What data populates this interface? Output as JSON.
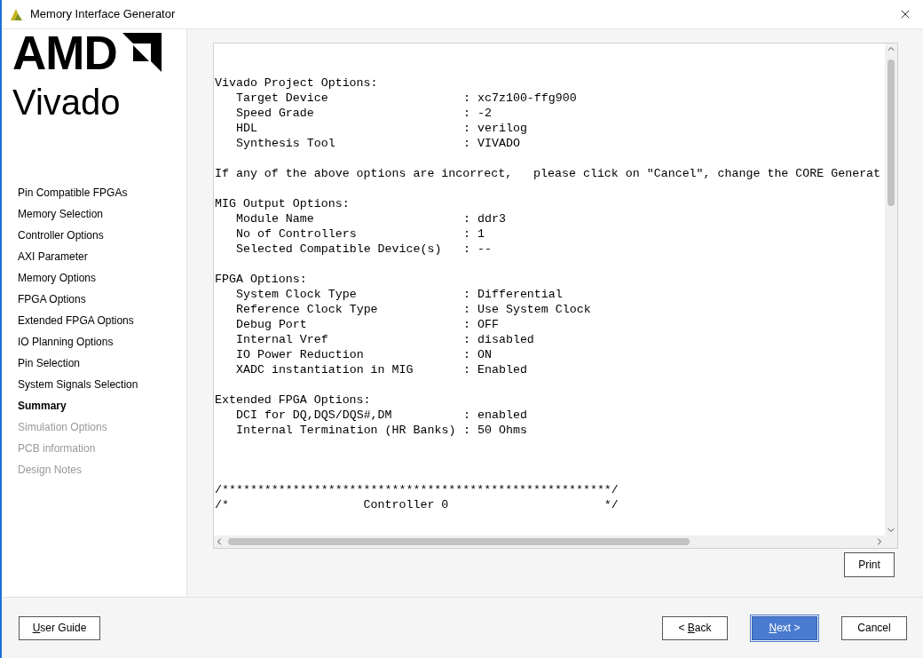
{
  "window": {
    "title": "Memory Interface Generator"
  },
  "logo": {
    "brand": "AMD",
    "product": "Vivado"
  },
  "sidebar": {
    "items": [
      {
        "label": "Pin Compatible FPGAs",
        "selected": false,
        "disabled": false
      },
      {
        "label": "Memory Selection",
        "selected": false,
        "disabled": false
      },
      {
        "label": "Controller Options",
        "selected": false,
        "disabled": false
      },
      {
        "label": "AXI Parameter",
        "selected": false,
        "disabled": false
      },
      {
        "label": "Memory Options",
        "selected": false,
        "disabled": false
      },
      {
        "label": "FPGA Options",
        "selected": false,
        "disabled": false
      },
      {
        "label": "Extended FPGA Options",
        "selected": false,
        "disabled": false
      },
      {
        "label": "IO Planning Options",
        "selected": false,
        "disabled": false
      },
      {
        "label": "Pin Selection",
        "selected": false,
        "disabled": false
      },
      {
        "label": "System Signals Selection",
        "selected": false,
        "disabled": false
      },
      {
        "label": "Summary",
        "selected": true,
        "disabled": false
      },
      {
        "label": "Simulation Options",
        "selected": false,
        "disabled": true
      },
      {
        "label": "PCB information",
        "selected": false,
        "disabled": true
      },
      {
        "label": "Design Notes",
        "selected": false,
        "disabled": true
      }
    ]
  },
  "report": {
    "separator": ":",
    "blocks": [
      {
        "kind": "section",
        "heading": "Vivado Project Options:",
        "rows": [
          {
            "label": "Target Device",
            "value": "xc7z100-ffg900"
          },
          {
            "label": "Speed Grade",
            "value": "-2"
          },
          {
            "label": "HDL",
            "value": "verilog"
          },
          {
            "label": "Synthesis Tool",
            "value": "VIVADO"
          }
        ]
      },
      {
        "kind": "note",
        "text": "If any of the above options are incorrect,   please click on \"Cancel\", change the CORE Generat"
      },
      {
        "kind": "section",
        "heading": "MIG Output Options:",
        "rows": [
          {
            "label": "Module Name",
            "value": "ddr3"
          },
          {
            "label": "No of Controllers",
            "value": "1"
          },
          {
            "label": "Selected Compatible Device(s)",
            "value": "--"
          }
        ]
      },
      {
        "kind": "section",
        "heading": "FPGA Options:",
        "rows": [
          {
            "label": "System Clock Type",
            "value": "Differential"
          },
          {
            "label": "Reference Clock Type",
            "value": "Use System Clock"
          },
          {
            "label": "Debug Port",
            "value": "OFF"
          },
          {
            "label": "Internal Vref",
            "value": "disabled"
          },
          {
            "label": "IO Power Reduction",
            "value": "ON"
          },
          {
            "label": "XADC instantiation in MIG",
            "value": "Enabled"
          }
        ]
      },
      {
        "kind": "section",
        "heading": "Extended FPGA Options:",
        "rows": [
          {
            "label": "DCI for DQ,DQS/DQS#,DM",
            "value": "enabled"
          },
          {
            "label": "Internal Termination (HR Banks)",
            "value": "50 Ohms"
          }
        ]
      },
      {
        "kind": "banner",
        "lines": [
          "/*******************************************************/",
          "/*                   Controller 0                      */"
        ]
      }
    ]
  },
  "print_button": {
    "label": "Print"
  },
  "footer": {
    "buttons": [
      {
        "kind": "plain",
        "parts": [
          {
            "text": "U",
            "underline": true
          },
          {
            "text": "ser Guide",
            "underline": false
          }
        ]
      },
      {
        "kind": "plain",
        "parts": [
          {
            "text": "< ",
            "underline": false
          },
          {
            "text": "B",
            "underline": true
          },
          {
            "text": "ack",
            "underline": false
          }
        ]
      },
      {
        "kind": "primary",
        "parts": [
          {
            "text": "N",
            "underline": true
          },
          {
            "text": "ext >",
            "underline": false
          }
        ]
      },
      {
        "kind": "plain",
        "parts": [
          {
            "text": "Cancel",
            "underline": false
          }
        ]
      }
    ]
  }
}
